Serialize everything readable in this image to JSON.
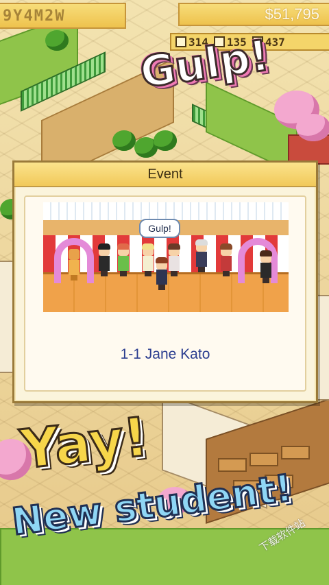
{
  "hud": {
    "date": "9Y4M2W",
    "money": "$51,795",
    "stats": [
      {
        "icon": "pencil-icon",
        "value": "314"
      },
      {
        "icon": "book-icon",
        "value": "135"
      },
      {
        "icon": "star-icon",
        "value": "437"
      }
    ]
  },
  "promo": {
    "gulp": "Gulp!",
    "yay": "Yay!",
    "new_student": "New student!"
  },
  "event": {
    "title": "Event",
    "bubble": "Gulp!",
    "caption": "1-1 Jane Kato"
  },
  "watermark": "下载软件站",
  "colors": {
    "dialog_header": "#f1c95a",
    "caption_text": "#2b3d8f",
    "yay_fill": "#f7d64a",
    "new_student_fill": "#8fd6f5",
    "gulp_shadow": "#f07bb6"
  }
}
